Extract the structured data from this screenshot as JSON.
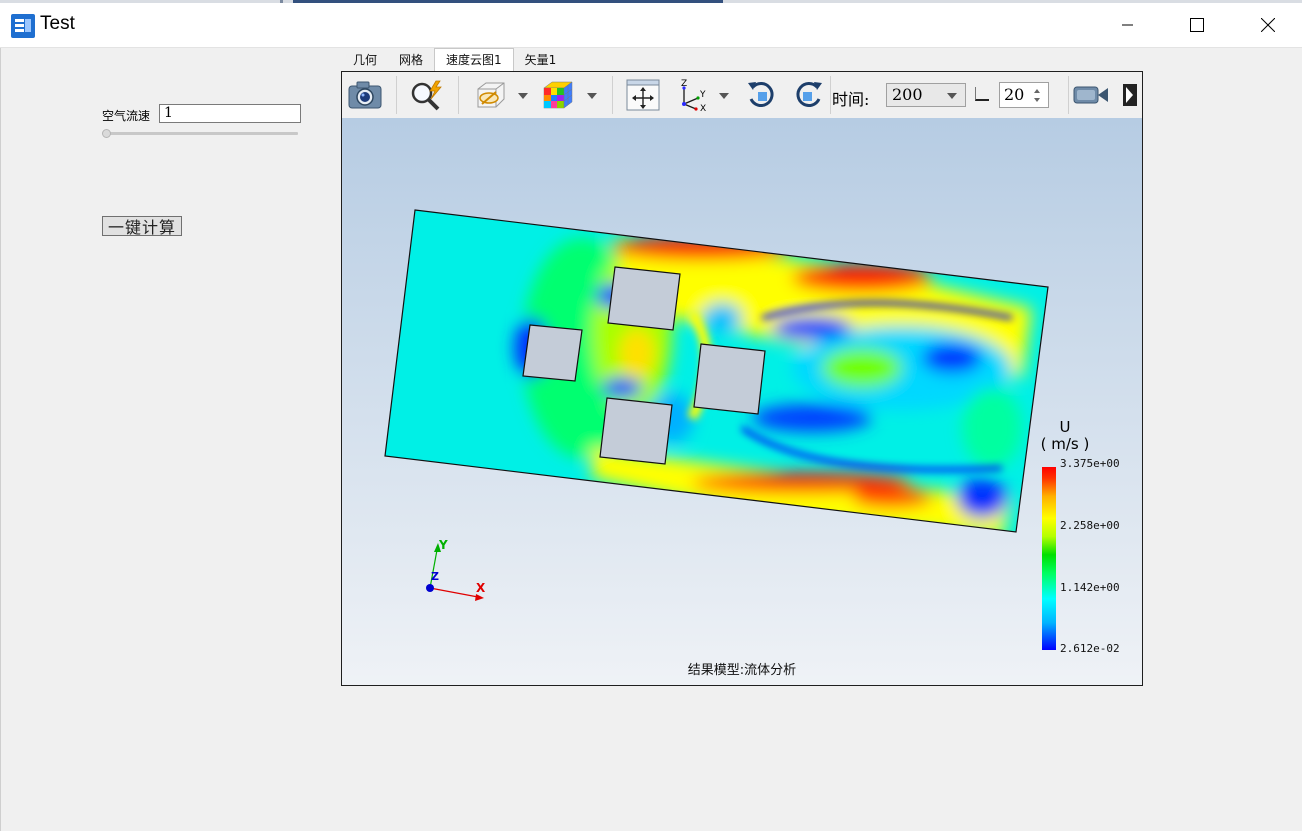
{
  "window": {
    "title": "Test",
    "controls": [
      "minimize",
      "maximize",
      "close"
    ]
  },
  "left_panel": {
    "speed_label": "空气流速",
    "speed_value": "1",
    "slider_level": 0,
    "calc_button": "一键计算"
  },
  "tabs": [
    {
      "label": "几何",
      "active": false
    },
    {
      "label": "网格",
      "active": false
    },
    {
      "label": "速度云图1",
      "active": true
    },
    {
      "label": "矢量1",
      "active": false
    }
  ],
  "toolbar": {
    "icons": [
      "camera-icon",
      "zoom-fit-icon",
      "hide-show-icon",
      "color-cube-icon",
      "pan-icon",
      "axes-orientation-icon",
      "rotate-cw-icon",
      "rotate-ccw-icon",
      "video-camera-icon",
      "expand-icon"
    ],
    "time_label": "时间:",
    "time_value": "200",
    "step_value": "20"
  },
  "viewport": {
    "result_label": "结果模型:流体分析",
    "axes": {
      "x": "X",
      "y": "Y",
      "z": "Z"
    },
    "axis_colors": {
      "x": "#e00000",
      "y": "#00b000",
      "z": "#0000d0"
    },
    "legend": {
      "title": "U",
      "unit": "( m/s )",
      "ticks": [
        "3.375e+00",
        "2.258e+00",
        "1.142e+00",
        "2.612e-02"
      ],
      "colors": [
        "#ff0000",
        "#ffff00",
        "#00ff00",
        "#00ffff",
        "#0000ff"
      ]
    }
  }
}
